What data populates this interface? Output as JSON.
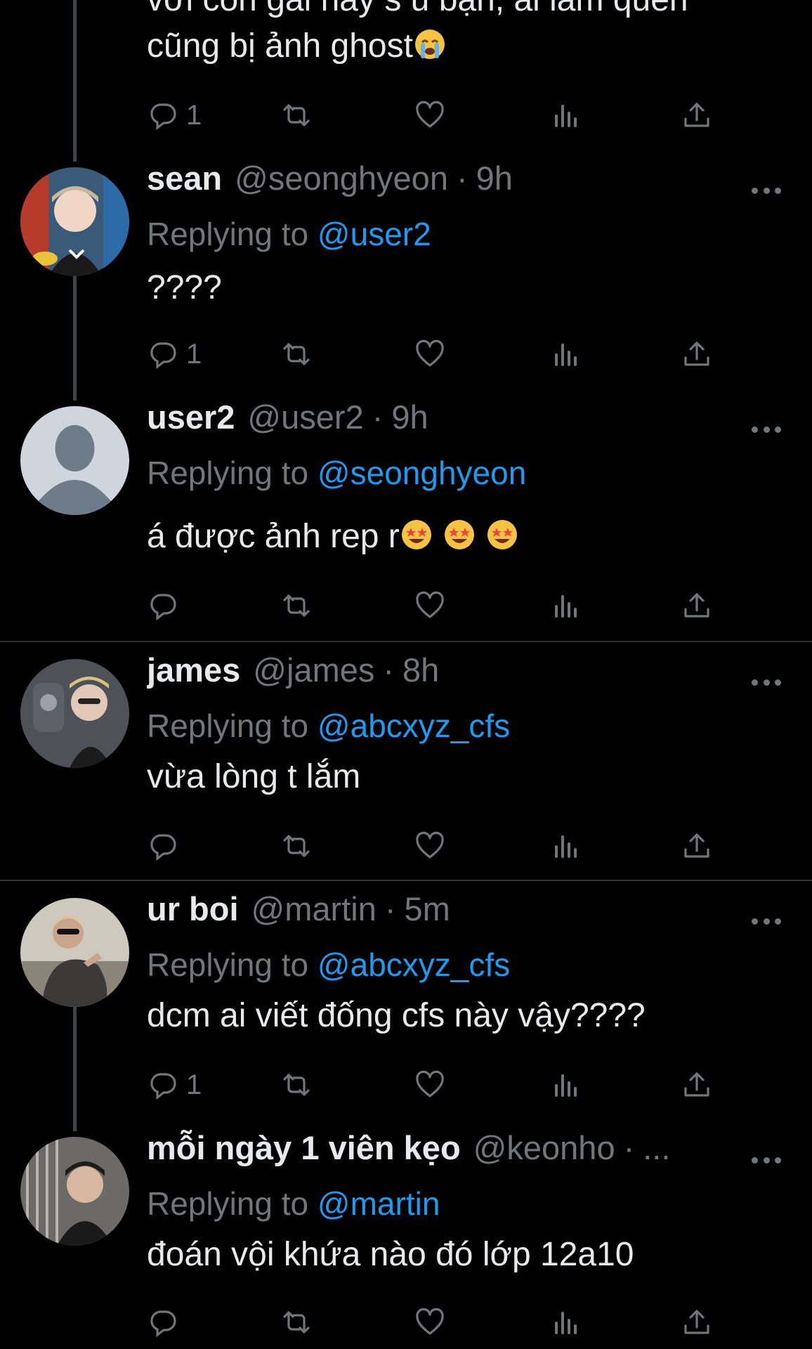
{
  "colors": {
    "background": "#000000",
    "primary_text": "#e7e9ea",
    "secondary_text": "#71767b",
    "mention": "#1d9bf0",
    "divider": "#2f3336",
    "thread_line": "#3f4448"
  },
  "top_fragment": {
    "clipped_line": "với con gái này s ủ bạn, ai làm quen",
    "text": "cũng bị ảnh ghost",
    "emoji": "loudly-crying-face",
    "reply_count": "1"
  },
  "tweets": [
    {
      "display_name": "sean",
      "handle": "@seonghyeon",
      "dot": "·",
      "time": "9h",
      "replying_prefix": "Replying to",
      "replying_to": "@user2",
      "text": "????",
      "reply_count": "1"
    },
    {
      "display_name": "user2",
      "handle": "@user2",
      "dot": "·",
      "time": "9h",
      "replying_prefix": "Replying to",
      "replying_to": "@seonghyeon",
      "text": "á được ảnh rep r",
      "emoji": [
        "star-struck",
        "star-struck",
        "star-struck"
      ],
      "reply_count": ""
    },
    {
      "display_name": "james",
      "handle": "@james",
      "dot": "·",
      "time": "8h",
      "replying_prefix": "Replying to",
      "replying_to": "@abcxyz_cfs",
      "text": "vừa lòng t lắm",
      "reply_count": ""
    },
    {
      "display_name": "ur boi",
      "handle": "@martin",
      "dot": "·",
      "time": "5m",
      "replying_prefix": "Replying to",
      "replying_to": "@abcxyz_cfs",
      "text": "dcm ai viết đống cfs này vậy????",
      "reply_count": "1"
    },
    {
      "display_name": "mỗi ngày 1 viên kẹo",
      "handle": "@keonho",
      "dot": "·",
      "time": "...",
      "replying_prefix": "Replying to",
      "replying_to": "@martin",
      "text": "đoán vội khứa nào đó lớp 12a10",
      "reply_count": ""
    }
  ],
  "icons": {
    "reply": "reply-icon",
    "retweet": "retweet-icon",
    "like": "heart-icon",
    "views": "views-icon",
    "share": "share-icon",
    "more": "more-icon"
  }
}
